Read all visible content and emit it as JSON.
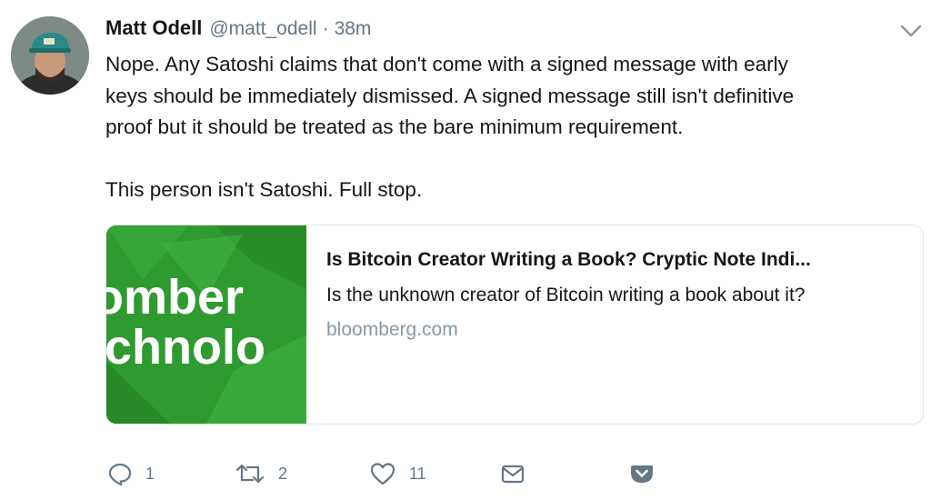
{
  "user": {
    "name": "Matt Odell",
    "handle": "@matt_odell",
    "separator": "·",
    "time": "38m"
  },
  "tweet": {
    "lines": [
      "Nope. Any Satoshi claims that don't come with a signed message with early",
      "keys should be immediately dismissed. A signed message still isn't definitive",
      "proof but it should be treated as the bare minimum requirement."
    ],
    "second_paragraph": "This person isn't Satoshi. Full stop."
  },
  "card": {
    "title": "Is Bitcoin Creator Writing a Book? Cryptic Note Indi...",
    "description": "Is the unknown creator of Bitcoin writing a book about it?",
    "domain": "bloomberg.com",
    "image_text_line1": "omber",
    "image_text_line2": "chnolo",
    "image_color": "#2f9a2f"
  },
  "actions": {
    "reply_count": "1",
    "retweet_count": "2",
    "like_count": "11"
  },
  "icons": {
    "caret": "chevron-down-icon",
    "reply": "reply-icon",
    "retweet": "retweet-icon",
    "like": "heart-icon",
    "dm": "envelope-icon",
    "pocket": "pocket-icon"
  },
  "colors": {
    "text": "#14171a",
    "secondary": "#657786",
    "domain": "#8899a6",
    "border": "#e1e8ed"
  }
}
